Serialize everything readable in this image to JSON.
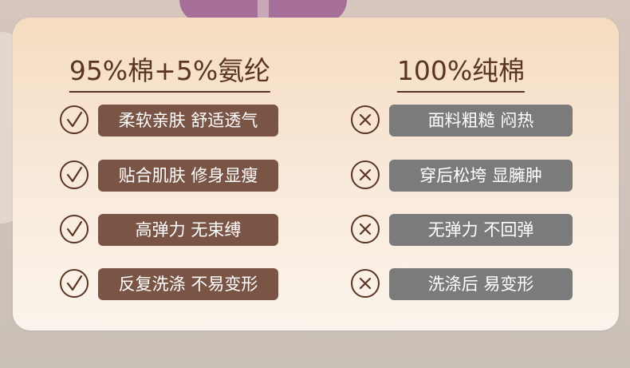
{
  "left_column": {
    "title": "95%棉+5%氨纶",
    "items": [
      {
        "icon": "check-circle-icon",
        "label": "柔软亲肤 舒适透气"
      },
      {
        "icon": "check-circle-icon",
        "label": "贴合肌肤 修身显瘦"
      },
      {
        "icon": "check-circle-icon",
        "label": "高弹力 无束缚"
      },
      {
        "icon": "check-circle-icon",
        "label": "反复洗涤 不易变形"
      }
    ]
  },
  "right_column": {
    "title": "100%纯棉",
    "items": [
      {
        "icon": "cross-circle-icon",
        "label": "面料粗糙 闷热"
      },
      {
        "icon": "cross-circle-icon",
        "label": "穿后松垮 显臃肿"
      },
      {
        "icon": "cross-circle-icon",
        "label": "无弹力 不回弹"
      },
      {
        "icon": "cross-circle-icon",
        "label": "洗涤后 易变形"
      }
    ]
  },
  "colors": {
    "positive_pill": "#7a5546",
    "negative_pill": "#7b7b7b",
    "title_text": "#5a3524"
  }
}
